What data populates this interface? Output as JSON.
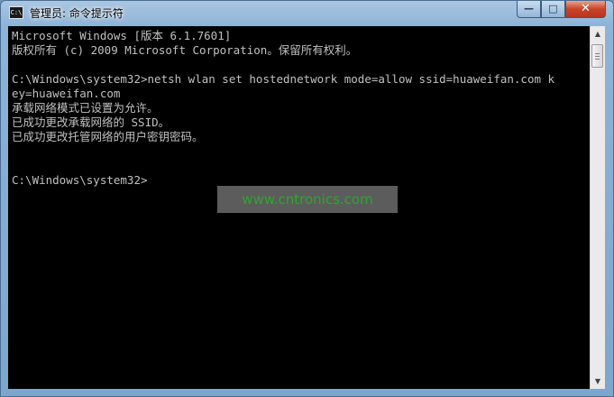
{
  "window": {
    "title": "管理员: 命令提示符",
    "icon_label": "C:\\",
    "controls": {
      "minimize": "—",
      "maximize": "□",
      "close": "✕"
    }
  },
  "console": {
    "lines": [
      "Microsoft Windows [版本 6.1.7601]",
      "版权所有 (c) 2009 Microsoft Corporation。保留所有权利。",
      "",
      "C:\\Windows\\system32>netsh wlan set hostednetwork mode=allow ssid=huaweifan.com k",
      "ey=huaweifan.com",
      "承载网络模式已设置为允许。",
      "已成功更改承载网络的 SSID。",
      "已成功更改托管网络的用户密钥密码。",
      "",
      "",
      "C:\\Windows\\system32>"
    ]
  },
  "watermark": "www.cntronics.com",
  "scrollbar": {
    "up_icon": "▲",
    "down_icon": "▼"
  },
  "colors": {
    "console_bg": "#000000",
    "console_text": "#c0c0c0",
    "watermark_text": "#2fa52f"
  }
}
